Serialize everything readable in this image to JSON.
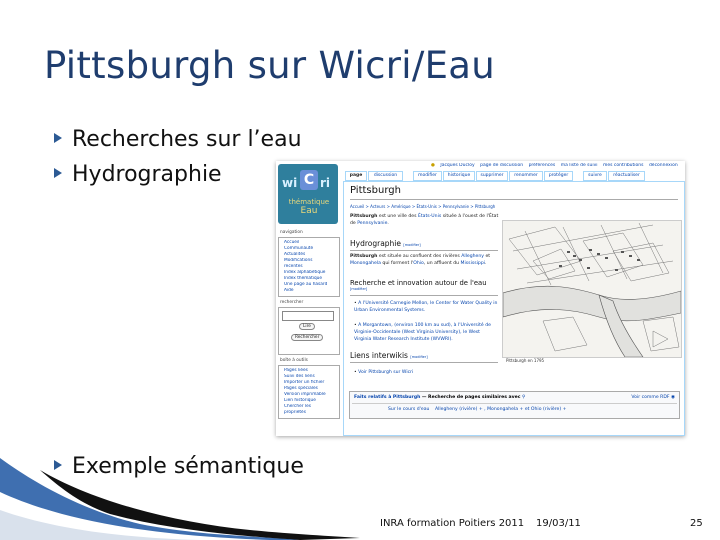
{
  "slide": {
    "title": "Pittsburgh sur Wicri/Eau",
    "bullets": [
      "Recherches sur l’eau",
      "Hydrographie",
      "Exemple sémantique"
    ],
    "footer": {
      "left": "INRA formation Poitiers 2011",
      "date": "19/03/11",
      "page": "25"
    }
  },
  "wiki": {
    "user_links": [
      "Jacques Ducloy",
      "page de discussion",
      "préférences",
      "ma liste de suivi",
      "mes contributions",
      "déconnexion"
    ],
    "tabs": [
      "page",
      "discussion",
      "modifier",
      "historique",
      "supprimer",
      "renommer",
      "protéger",
      "suivre",
      "réactualiser"
    ],
    "logo": {
      "left": "wi",
      "center": "C",
      "right": "ri",
      "sub1": "thématique",
      "sub2": "Eau"
    },
    "sidebar": {
      "nav_heading": "navigation",
      "nav_items": [
        "Accueil",
        "Communauté",
        "Actualités",
        "Modifications",
        "récentes",
        "Index alphabétique",
        "Index thématique",
        "Une page au hasard",
        "Aide"
      ],
      "search_heading": "rechercher",
      "search_buttons": [
        "Lire",
        "Rechercher"
      ],
      "tools_heading": "boîte à outils",
      "tools_items": [
        "Pages liées",
        "Suivi des liens",
        "Importer un fichier",
        "Pages spéciales",
        "Version imprimable",
        "Lien historique",
        "Chercher les",
        "propriétés"
      ]
    },
    "page_title": "Pittsburgh",
    "breadcrumb": "Accueil > Acteurs > Amérique > États-Unis > Pennsylvanie > Pittsburgh",
    "intro": {
      "bold": "Pittsburgh",
      "t1": " est une ville des ",
      "l1": "États-Unis",
      "t2": " située à l'ouest de l'État de ",
      "l2": "Pennsylvanie",
      "t3": "."
    },
    "section_hydro": {
      "title": "Hydrographie",
      "edit": "[modifier]",
      "bold": "Pittsburgh",
      "t1": " est située au confluent des rivières ",
      "l1": "Allegheny",
      "t2": " et ",
      "l2": "Monongahela",
      "t3": " qui forment l'",
      "l3": "Ohio",
      "t4": ", un affluent du ",
      "l4": "Mississippi",
      "t5": "."
    },
    "section_research": {
      "title": "Recherche et innovation autour de l'eau",
      "edit": "[modifier]",
      "item1": "A l'Université Carnegie Mellon, le Center for Water Quality in Urban Environmental Systems.",
      "item2": "A Morgantown, (environ 100 km au sud), à l'Université de Virginie-Occidentale (West Virginia University), le West Virginia Water Research Institute (WVWRI)."
    },
    "section_links": {
      "title": "Liens interwikis",
      "edit": "[modifier]",
      "item": "Voir Pittsburgh sur Wicri"
    },
    "map_caption": "Pittsburgh en 1795",
    "facet": {
      "label": "Faits relatifs à Pittsburgh",
      "search": "— Recherche de pages similaires avec",
      "rdf": "Voir comme RDF",
      "prop": "Sur le cours d'eau",
      "values": "Allegheny (rivière) + , Monongahela + et Ohio (rivière) +"
    }
  }
}
